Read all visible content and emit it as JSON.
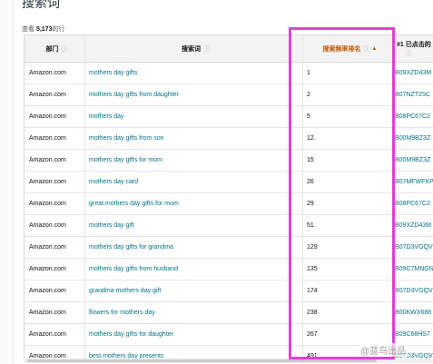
{
  "title": "搜索词",
  "row_count": {
    "prefix": "查看",
    "count": "5,173",
    "suffix": "的行"
  },
  "columns": {
    "department": "部门",
    "search_term": "搜索词",
    "rank": "搜索频率排名",
    "clicked_asin_line1": "#1 已点击的",
    "info_glyph": "ⓘ",
    "sort_glyph": "▲"
  },
  "rows": [
    {
      "dept": "Amazon.com",
      "term": "mothers day gifts",
      "rank": "1",
      "asin": "B09XZD43M"
    },
    {
      "dept": "Amazon.com",
      "term": "mothers day gifts from daughter",
      "rank": "2",
      "asin": "B07NZT25C"
    },
    {
      "dept": "Amazon.com",
      "term": "mothers day",
      "rank": "5",
      "asin": "B08PC67C2"
    },
    {
      "dept": "Amazon.com",
      "term": "mothers day gifts from son",
      "rank": "12",
      "asin": "B00M9BZ3Z"
    },
    {
      "dept": "Amazon.com",
      "term": "mothers day gifts for mom",
      "rank": "15",
      "asin": "B00M9BZ3Z"
    },
    {
      "dept": "Amazon.com",
      "term": "mothers day card",
      "rank": "26",
      "asin": "B07MFWFKP"
    },
    {
      "dept": "Amazon.com",
      "term": "great mothers day gifts for mom",
      "rank": "29",
      "asin": "B08PC67C2"
    },
    {
      "dept": "Amazon.com",
      "term": "mothers day gift",
      "rank": "51",
      "asin": "B09XZD43M"
    },
    {
      "dept": "Amazon.com",
      "term": "mothers day gifts for grandma",
      "rank": "129",
      "asin": "B07D3VGQV"
    },
    {
      "dept": "Amazon.com",
      "term": "mothers day gifts from husband",
      "rank": "135",
      "asin": "B09C7MNGN"
    },
    {
      "dept": "Amazon.com",
      "term": "grandma mothers day gift",
      "rank": "174",
      "asin": "B07D3VGQV"
    },
    {
      "dept": "Amazon.com",
      "term": "flowers for mothers day",
      "rank": "238",
      "asin": "B00KWX688"
    },
    {
      "dept": "Amazon.com",
      "term": "mothers day gifts for daughter",
      "rank": "267",
      "asin": "B09C68HS7"
    },
    {
      "dept": "Amazon.com",
      "term": "best mothers day presents",
      "rank": "491",
      "asin": "B07D3VGQV"
    }
  ],
  "watermark": "@蓝鸟出品",
  "colors": {
    "highlight": "#e040d8",
    "link": "#007185",
    "sorted_header": "#c45500"
  }
}
